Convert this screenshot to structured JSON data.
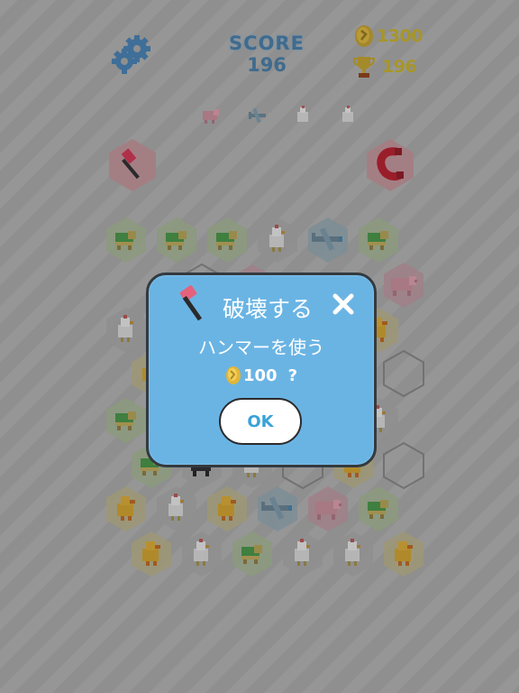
{
  "hud": {
    "score_label": "SCORE",
    "score_value": "196",
    "coins": "1300",
    "best": "196"
  },
  "next_animals": [
    "pig",
    "plane",
    "chicken",
    "chicken"
  ],
  "powerups": {
    "left": "hammer",
    "right": "magnet"
  },
  "board": {
    "cells": [
      {
        "animal": "turtle"
      },
      {
        "animal": "turtle"
      },
      {
        "animal": "turtle"
      },
      {
        "animal": "chicken"
      },
      {
        "animal": "plane"
      },
      {
        "animal": "turtle"
      },
      {
        "animal": "empty"
      },
      {
        "animal": "pig"
      },
      {
        "animal": "pig"
      },
      {
        "animal": "chicken"
      },
      {
        "animal": "duck"
      },
      {
        "animal": "duck"
      },
      {
        "animal": "empty"
      },
      {
        "animal": "turtle"
      },
      {
        "animal": "chicken"
      },
      {
        "animal": "turtle"
      },
      {
        "animal": "cow"
      },
      {
        "animal": "chicken"
      },
      {
        "animal": "empty"
      },
      {
        "animal": "duck"
      },
      {
        "animal": "empty"
      },
      {
        "animal": "duck"
      },
      {
        "animal": "chicken"
      },
      {
        "animal": "duck"
      },
      {
        "animal": "plane"
      },
      {
        "animal": "pig"
      },
      {
        "animal": "turtle"
      },
      {
        "animal": "duck"
      },
      {
        "animal": "chicken"
      },
      {
        "animal": "turtle"
      },
      {
        "animal": "chicken"
      },
      {
        "animal": "chicken"
      },
      {
        "animal": "duck"
      }
    ]
  },
  "dialog": {
    "title": "破壊する",
    "message": "ハンマーを使う",
    "cost": "100",
    "question": "?",
    "ok_label": "OK"
  },
  "colors": {
    "dialog_bg": "#6ab4e4",
    "ok_text": "#3aa2d8",
    "score_text": "#3f6b8e",
    "hud_gold": "#a79627"
  }
}
